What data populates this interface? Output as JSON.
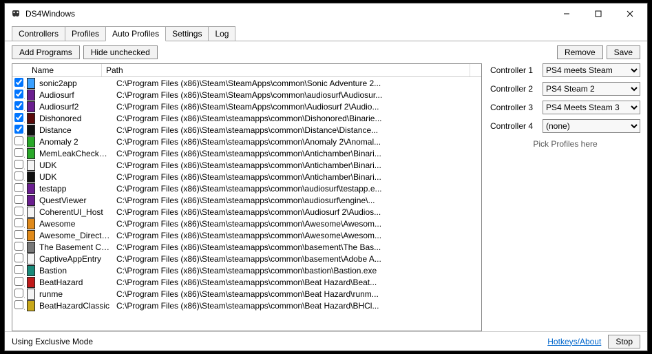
{
  "window": {
    "title": "DS4Windows"
  },
  "tabs": {
    "items": [
      "Controllers",
      "Profiles",
      "Auto Profiles",
      "Settings",
      "Log"
    ],
    "active": 2
  },
  "toolbar": {
    "add_programs": "Add Programs",
    "hide_unchecked": "Hide unchecked",
    "remove": "Remove",
    "save": "Save"
  },
  "list": {
    "cols": {
      "name": "Name",
      "path": "Path"
    },
    "rows": [
      {
        "checked": true,
        "icon": "blue",
        "name": "sonic2app",
        "path": "C:\\Program Files (x86)\\Steam\\SteamApps\\common\\Sonic Adventure 2..."
      },
      {
        "checked": true,
        "icon": "purple",
        "name": "Audiosurf",
        "path": "C:\\Program Files (x86)\\Steam\\SteamApps\\common\\audiosurf\\Audiosur..."
      },
      {
        "checked": true,
        "icon": "purple",
        "name": "Audiosurf2",
        "path": "C:\\Program Files (x86)\\Steam\\SteamApps\\common\\Audiosurf 2\\Audio..."
      },
      {
        "checked": true,
        "icon": "darkred",
        "name": "Dishonored",
        "path": "C:\\Program Files (x86)\\Steam\\steamapps\\common\\Dishonored\\Binarie..."
      },
      {
        "checked": true,
        "icon": "black",
        "name": "Distance",
        "path": "C:\\Program Files (x86)\\Steam\\steamapps\\common\\Distance\\Distance..."
      },
      {
        "checked": false,
        "icon": "green",
        "name": "Anomaly 2",
        "path": "C:\\Program Files (x86)\\Steam\\steamapps\\common\\Anomaly 2\\Anomal..."
      },
      {
        "checked": false,
        "icon": "green",
        "name": "MemLeakCheckDif...",
        "path": "C:\\Program Files (x86)\\Steam\\steamapps\\common\\Antichamber\\Binari..."
      },
      {
        "checked": false,
        "icon": "white",
        "name": "UDK",
        "path": "C:\\Program Files (x86)\\Steam\\steamapps\\common\\Antichamber\\Binari..."
      },
      {
        "checked": false,
        "icon": "black",
        "name": "UDK",
        "path": "C:\\Program Files (x86)\\Steam\\steamapps\\common\\Antichamber\\Binari..."
      },
      {
        "checked": false,
        "icon": "purple",
        "name": "testapp",
        "path": "C:\\Program Files (x86)\\Steam\\steamapps\\common\\audiosurf\\testapp.e..."
      },
      {
        "checked": false,
        "icon": "purple",
        "name": "QuestViewer",
        "path": "C:\\Program Files (x86)\\Steam\\steamapps\\common\\audiosurf\\engine\\..."
      },
      {
        "checked": false,
        "icon": "white",
        "name": "CoherentUI_Host",
        "path": "C:\\Program Files (x86)\\Steam\\steamapps\\common\\Audiosurf 2\\Audios..."
      },
      {
        "checked": false,
        "icon": "orange",
        "name": "Awesome",
        "path": "C:\\Program Files (x86)\\Steam\\steamapps\\common\\Awesome\\Awesom..."
      },
      {
        "checked": false,
        "icon": "orange",
        "name": "Awesome_DirectT...",
        "path": "C:\\Program Files (x86)\\Steam\\steamapps\\common\\Awesome\\Awesom..."
      },
      {
        "checked": false,
        "icon": "gray",
        "name": "The Basement Coll...",
        "path": "C:\\Program Files (x86)\\Steam\\steamapps\\common\\basement\\The Bas..."
      },
      {
        "checked": false,
        "icon": "white",
        "name": "CaptiveAppEntry",
        "path": "C:\\Program Files (x86)\\Steam\\steamapps\\common\\basement\\Adobe A..."
      },
      {
        "checked": false,
        "icon": "teal",
        "name": "Bastion",
        "path": "C:\\Program Files (x86)\\Steam\\steamapps\\common\\bastion\\Bastion.exe"
      },
      {
        "checked": false,
        "icon": "red",
        "name": "BeatHazard",
        "path": "C:\\Program Files (x86)\\Steam\\steamapps\\common\\Beat Hazard\\Beat..."
      },
      {
        "checked": false,
        "icon": "white",
        "name": "runme",
        "path": "C:\\Program Files (x86)\\Steam\\steamapps\\common\\Beat Hazard\\runm..."
      },
      {
        "checked": false,
        "icon": "gold",
        "name": "BeatHazardClassic",
        "path": "C:\\Program Files (x86)\\Steam\\steamapps\\common\\Beat Hazard\\BHCl..."
      }
    ]
  },
  "side": {
    "controllers": [
      {
        "label": "Controller 1",
        "value": "PS4 meets Steam"
      },
      {
        "label": "Controller 2",
        "value": "PS4 Steam 2"
      },
      {
        "label": "Controller 3",
        "value": "PS4 Meets Steam 3"
      },
      {
        "label": "Controller 4",
        "value": "(none)"
      }
    ],
    "hint": "Pick Profiles here"
  },
  "status": {
    "mode": "Using Exclusive Mode",
    "hotkeys": "Hotkeys/About",
    "stop": "Stop"
  },
  "icon_colors": {
    "blue": "#3aa0ff",
    "purple": "#6a1e8f",
    "darkred": "#5a0a0a",
    "black": "#111",
    "green": "#2aa82a",
    "white": "#f4f4f4",
    "orange": "#e08a1a",
    "gray": "#777",
    "teal": "#1a8a7a",
    "red": "#c01a1a",
    "gold": "#c8a81a"
  }
}
